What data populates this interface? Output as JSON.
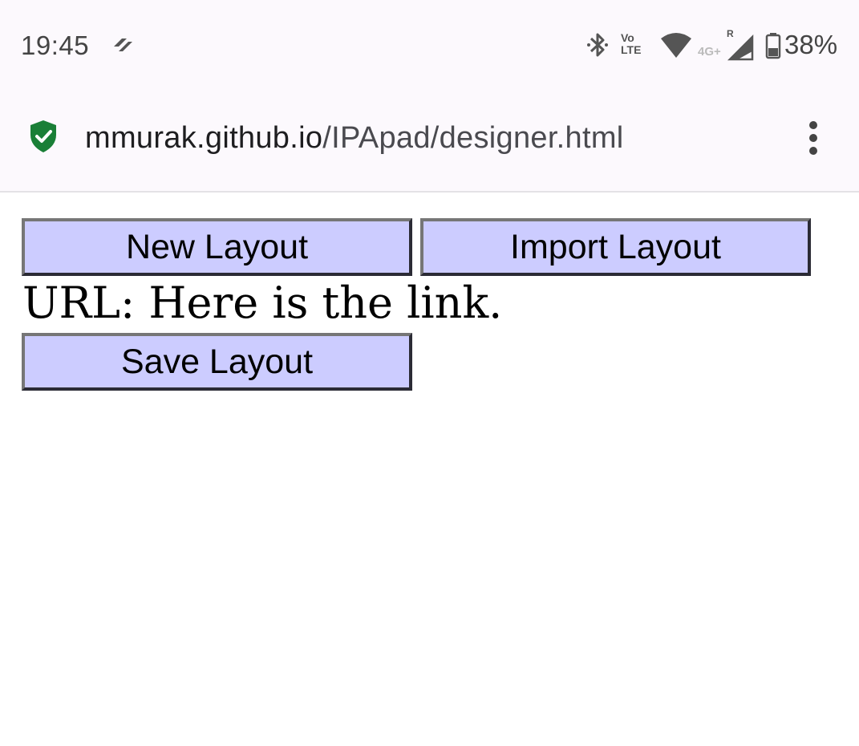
{
  "status_bar": {
    "time": "19:45",
    "volte_label_top": "Vo",
    "volte_label_bottom": "LTE",
    "network_label": "4G+",
    "roaming_label": "R",
    "battery": "38%",
    "icons": [
      "notification-icon",
      "bluetooth-icon",
      "volte-icon",
      "wifi-icon",
      "cellular-signal-icon",
      "battery-icon"
    ]
  },
  "browser": {
    "url_host": "mmurak.github.io",
    "url_path": "/IPApad/designer.html",
    "secure_icon": "shield-check-icon",
    "menu_icon": "overflow-menu-icon",
    "secure_color": "#1a7f37"
  },
  "page": {
    "new_layout_label": "New Layout",
    "import_layout_label": "Import Layout",
    "url_prefix": "URL: ",
    "url_link_text": "Here is the link.",
    "save_layout_label": "Save Layout",
    "button_color": "#ccccff"
  }
}
